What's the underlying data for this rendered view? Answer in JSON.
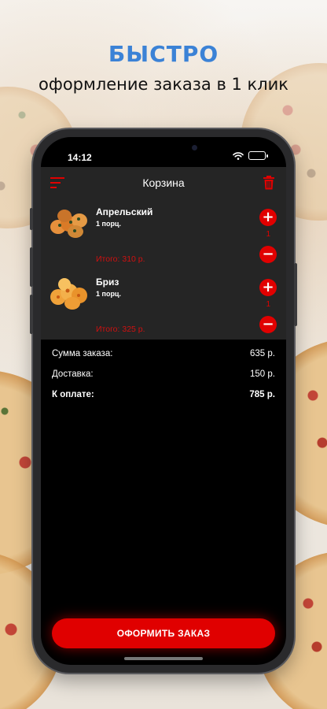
{
  "promo": {
    "headline": "БЫСТРО",
    "subline": "оформление заказа в 1 клик"
  },
  "status_bar": {
    "time": "14:12"
  },
  "app_bar": {
    "title": "Корзина",
    "menu_icon": "menu-icon",
    "trash_icon": "trash-icon"
  },
  "cart": {
    "items": [
      {
        "name": "Апрельский",
        "portion": "1 порц.",
        "total": "Итого: 310 р.",
        "quantity": "1",
        "plus": "+",
        "minus": "−"
      },
      {
        "name": "Бриз",
        "portion": "1 порц.",
        "total": "Итого: 325 р.",
        "quantity": "1",
        "plus": "+",
        "minus": "−"
      }
    ]
  },
  "summary": {
    "order_sum_label": "Сумма заказа:",
    "order_sum_value": "635 р.",
    "delivery_label": "Доставка:",
    "delivery_value": "150 р.",
    "to_pay_label": "К оплате:",
    "to_pay_value": "785 р."
  },
  "checkout": {
    "button_label": "ОФОРМИТЬ ЗАКАЗ"
  },
  "colors": {
    "accent": "#e00000",
    "headline": "#3b82d6",
    "screen_bg": "#000000",
    "panel_bg": "#252525"
  }
}
